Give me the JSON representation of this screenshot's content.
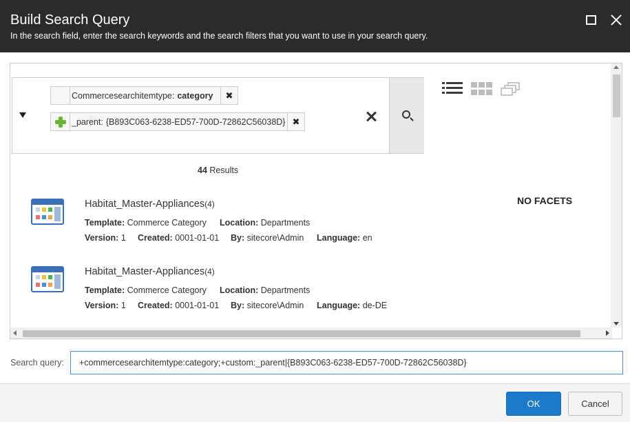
{
  "dialog": {
    "title": "Build Search Query",
    "subtitle": "In the search field, enter the search keywords and the search filters that you want to use in your search query."
  },
  "search": {
    "filters": [
      {
        "name": "Commercesearchitemtype:",
        "value": "category",
        "remove": "✖"
      },
      {
        "name": "_parent:",
        "value": "{B893C063-6238-ED57-700D-72862C56038D}",
        "remove": "✖"
      }
    ]
  },
  "results": {
    "count": "44",
    "count_label": "Results",
    "facets_label": "NO FACETS",
    "items": [
      {
        "name": "Habitat_Master-Appliances",
        "children": "(4)",
        "template_label": "Template:",
        "template": "Commerce Category",
        "location_label": "Location:",
        "location": "Departments",
        "version_label": "Version:",
        "version": "1",
        "created_label": "Created:",
        "created": "0001-01-01",
        "by_label": "By:",
        "by": "sitecore\\Admin",
        "language_label": "Language:",
        "language": "en"
      },
      {
        "name": "Habitat_Master-Appliances",
        "children": "(4)",
        "template_label": "Template:",
        "template": "Commerce Category",
        "location_label": "Location:",
        "location": "Departments",
        "version_label": "Version:",
        "version": "1",
        "created_label": "Created:",
        "created": "0001-01-01",
        "by_label": "By:",
        "by": "sitecore\\Admin",
        "language_label": "Language:",
        "language": "de-DE"
      }
    ]
  },
  "query": {
    "label": "Search query:",
    "value": "+commercesearchitemtype:category;+custom:_parent|{B893C063-6238-ED57-700D-72862C56038D}"
  },
  "footer": {
    "ok_label": "OK",
    "cancel_label": "Cancel"
  },
  "colors": {
    "header_bg": "#2b2b2b",
    "accent": "#1b7ac9",
    "item_icon": "#3a6fb7",
    "add_icon": "#6bb534"
  },
  "icons": [
    "maximize-icon",
    "close-icon",
    "dropdown-arrow-icon",
    "add-filter-icon",
    "remove-icon",
    "clear-icon",
    "search-icon",
    "list-view-icon",
    "grid-view-icon",
    "stacked-view-icon",
    "item-icon"
  ]
}
